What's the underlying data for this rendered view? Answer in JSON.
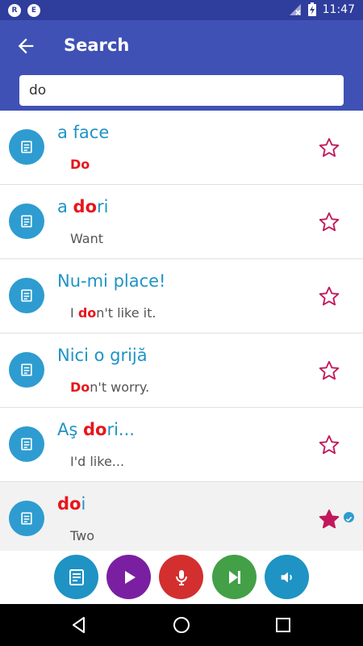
{
  "status_bar": {
    "notif_1": "R",
    "notif_2": "E",
    "time": "11:47",
    "icons": [
      "no-signal-icon",
      "battery-charging-icon"
    ]
  },
  "toolbar": {
    "title": "Search",
    "back_icon": "arrow-left-icon"
  },
  "search": {
    "value": "do"
  },
  "results": [
    {
      "title": [
        {
          "t": "a face"
        }
      ],
      "sub": [
        {
          "t": "Do",
          "h": true
        }
      ],
      "starred": false
    },
    {
      "title": [
        {
          "t": "a "
        },
        {
          "t": "do",
          "h": true
        },
        {
          "t": "ri"
        }
      ],
      "sub": [
        {
          "t": "Want"
        }
      ],
      "starred": false
    },
    {
      "title": [
        {
          "t": "Nu-mi place!"
        }
      ],
      "sub": [
        {
          "t": "I "
        },
        {
          "t": "do",
          "h": true
        },
        {
          "t": "n't like it."
        }
      ],
      "starred": false
    },
    {
      "title": [
        {
          "t": "Nici o grijă"
        }
      ],
      "sub": [
        {
          "t": "Do",
          "h": true
        },
        {
          "t": "n't worry."
        }
      ],
      "starred": false
    },
    {
      "title": [
        {
          "t": "Aş "
        },
        {
          "t": "do",
          "h": true
        },
        {
          "t": "ri..."
        }
      ],
      "sub": [
        {
          "t": "I'd like..."
        }
      ],
      "starred": false
    },
    {
      "title": [
        {
          "t": "do",
          "h": true
        },
        {
          "t": "i"
        }
      ],
      "sub": [
        {
          "t": "Two"
        }
      ],
      "starred": true,
      "learned": true
    }
  ],
  "bottom_actions": [
    {
      "name": "notes-button",
      "icon": "notes-icon",
      "color": "#1e93c4"
    },
    {
      "name": "play-button",
      "icon": "play-icon",
      "color": "#7b1fa2"
    },
    {
      "name": "record-button",
      "icon": "microphone-icon",
      "color": "#d32f2f"
    },
    {
      "name": "next-button",
      "icon": "skip-next-icon",
      "color": "#43a047"
    },
    {
      "name": "volume-button",
      "icon": "volume-icon",
      "color": "#1e93c4"
    }
  ],
  "colors": {
    "primary": "#3f51b5",
    "status_bar": "#2f3d9c",
    "accent": "#2e9cd0",
    "highlight": "#e8161b",
    "star": "#c2185b"
  }
}
